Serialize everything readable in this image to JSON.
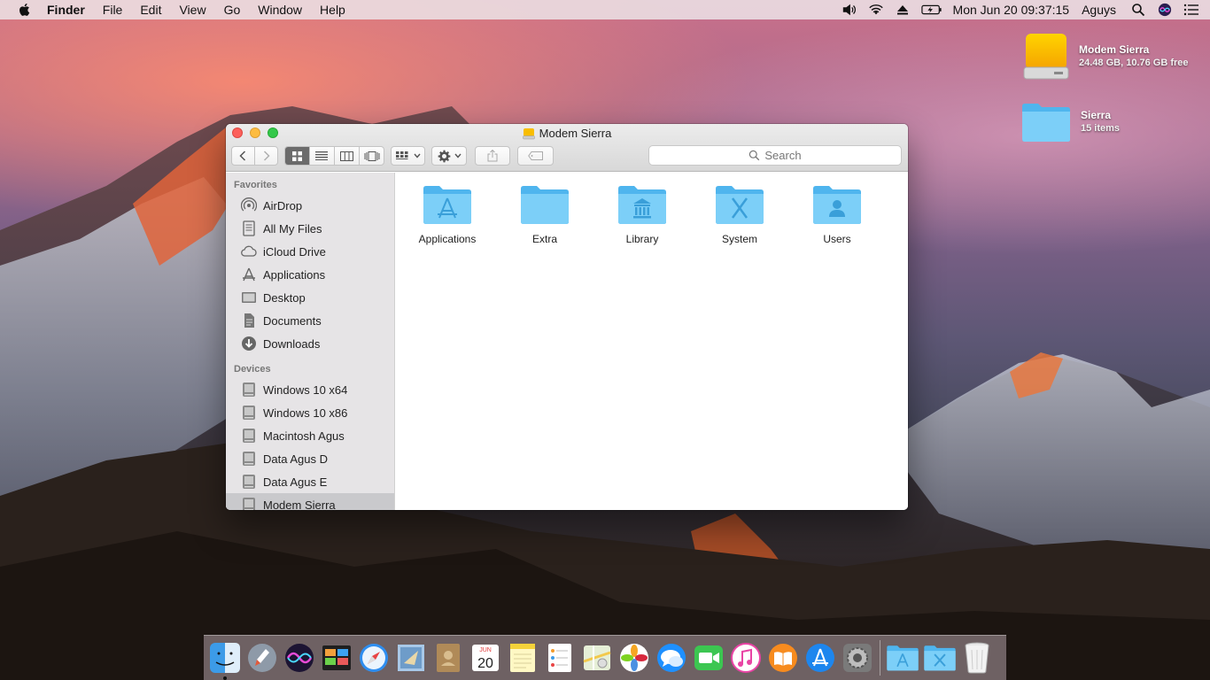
{
  "menubar": {
    "app_name": "Finder",
    "menus": [
      "File",
      "Edit",
      "View",
      "Go",
      "Window",
      "Help"
    ],
    "clock": "Mon Jun 20  09:37:15",
    "user": "Aguys"
  },
  "desktop": {
    "icons": [
      {
        "name": "Modem Sierra",
        "detail": "24.48 GB, 10.76 GB free",
        "icon": "hard-drive-icon"
      },
      {
        "name": "Sierra",
        "detail": "15 items",
        "icon": "folder-icon"
      }
    ]
  },
  "window": {
    "title": "Modem Sierra",
    "search_placeholder": "Search",
    "sidebar": {
      "favorites_header": "Favorites",
      "favorites": [
        {
          "label": "AirDrop",
          "icon": "airdrop-icon"
        },
        {
          "label": "All My Files",
          "icon": "all-files-icon"
        },
        {
          "label": "iCloud Drive",
          "icon": "cloud-icon"
        },
        {
          "label": "Applications",
          "icon": "applications-icon"
        },
        {
          "label": "Desktop",
          "icon": "desktop-icon"
        },
        {
          "label": "Documents",
          "icon": "documents-icon"
        },
        {
          "label": "Downloads",
          "icon": "downloads-icon"
        }
      ],
      "devices_header": "Devices",
      "devices": [
        {
          "label": "Windows 10 x64",
          "icon": "disk-icon"
        },
        {
          "label": "Windows 10 x86",
          "icon": "disk-icon"
        },
        {
          "label": "Macintosh Agus",
          "icon": "disk-icon"
        },
        {
          "label": "Data Agus D",
          "icon": "disk-icon"
        },
        {
          "label": "Data Agus E",
          "icon": "disk-icon"
        },
        {
          "label": "Modem Sierra",
          "icon": "disk-icon"
        }
      ]
    },
    "folders": [
      {
        "label": "Applications",
        "glyph": "applications"
      },
      {
        "label": "Extra",
        "glyph": "none"
      },
      {
        "label": "Library",
        "glyph": "library"
      },
      {
        "label": "System",
        "glyph": "system"
      },
      {
        "label": "Users",
        "glyph": "users"
      }
    ]
  },
  "dock": {
    "calendar_month": "JUN",
    "calendar_day": "20"
  },
  "colors": {
    "folder_blue": "#6cc5f5",
    "folder_dark": "#3fa7e4",
    "selection_gray": "#c9c9cc"
  }
}
